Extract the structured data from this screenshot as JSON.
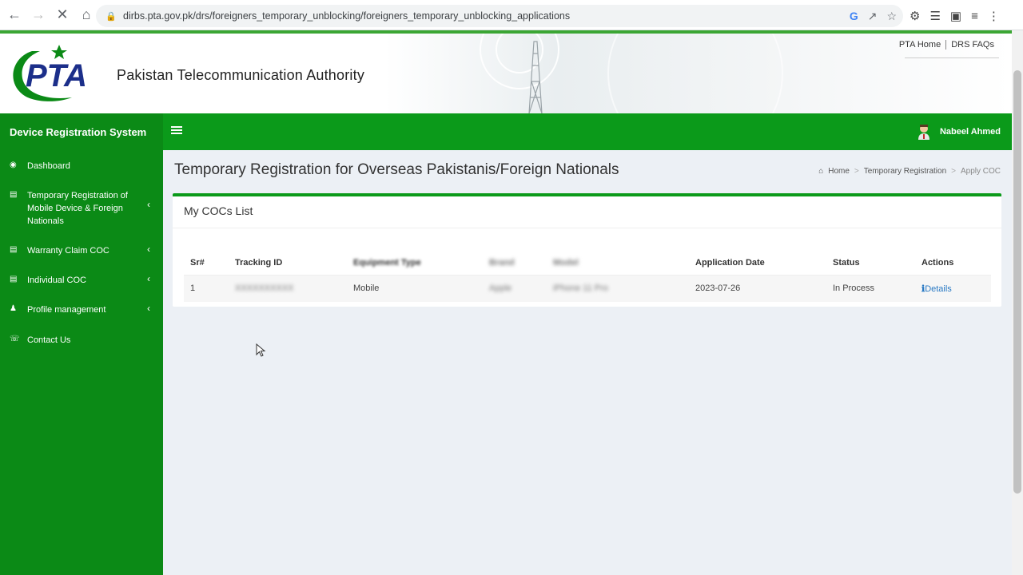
{
  "browser": {
    "url": "dirbs.pta.gov.pk/drs/foreigners_temporary_unblocking/foreigners_temporary_unblocking_applications"
  },
  "header": {
    "logo_text": "PTA",
    "org_name": "Pakistan Telecommunication Authority",
    "links": [
      "PTA Home",
      "DRS FAQs"
    ]
  },
  "navbar": {
    "brand": "Device Registration System",
    "user_name": "Nabeel Ahmed"
  },
  "sidebar": {
    "items": [
      {
        "label": "Dashboard",
        "icon": "dashboard-icon",
        "has_submenu": false
      },
      {
        "label": "Temporary Registration of Mobile Device & Foreign Nationals",
        "icon": "document-icon",
        "has_submenu": true
      },
      {
        "label": "Warranty Claim COC",
        "icon": "document-icon",
        "has_submenu": true
      },
      {
        "label": "Individual COC",
        "icon": "document-icon",
        "has_submenu": true
      },
      {
        "label": "Profile management",
        "icon": "user-icon",
        "has_submenu": true
      },
      {
        "label": "Contact Us",
        "icon": "phone-icon",
        "has_submenu": false
      }
    ]
  },
  "main": {
    "title": "Temporary Registration for Overseas Pakistanis/Foreign Nationals",
    "breadcrumb": [
      "Home",
      "Temporary Registration",
      "Apply COC"
    ],
    "box_title": "My COCs List",
    "table": {
      "headers": [
        "Sr#",
        "Tracking ID",
        "Equipment Type",
        "Brand",
        "Model",
        "Application Date",
        "Status",
        "Actions"
      ],
      "rows": [
        {
          "sr": "1",
          "tracking_id": "XXXXXXXXXX",
          "equipment": "Mobile",
          "brand": "Apple",
          "model": "iPhone 11 Pro",
          "date": "2023-07-26",
          "status": "In Process",
          "action": "Details"
        }
      ]
    }
  },
  "colors": {
    "nav_green": "#0b9a1a",
    "sidebar_green": "#0b8a16",
    "link_blue": "#2a7ac4"
  }
}
